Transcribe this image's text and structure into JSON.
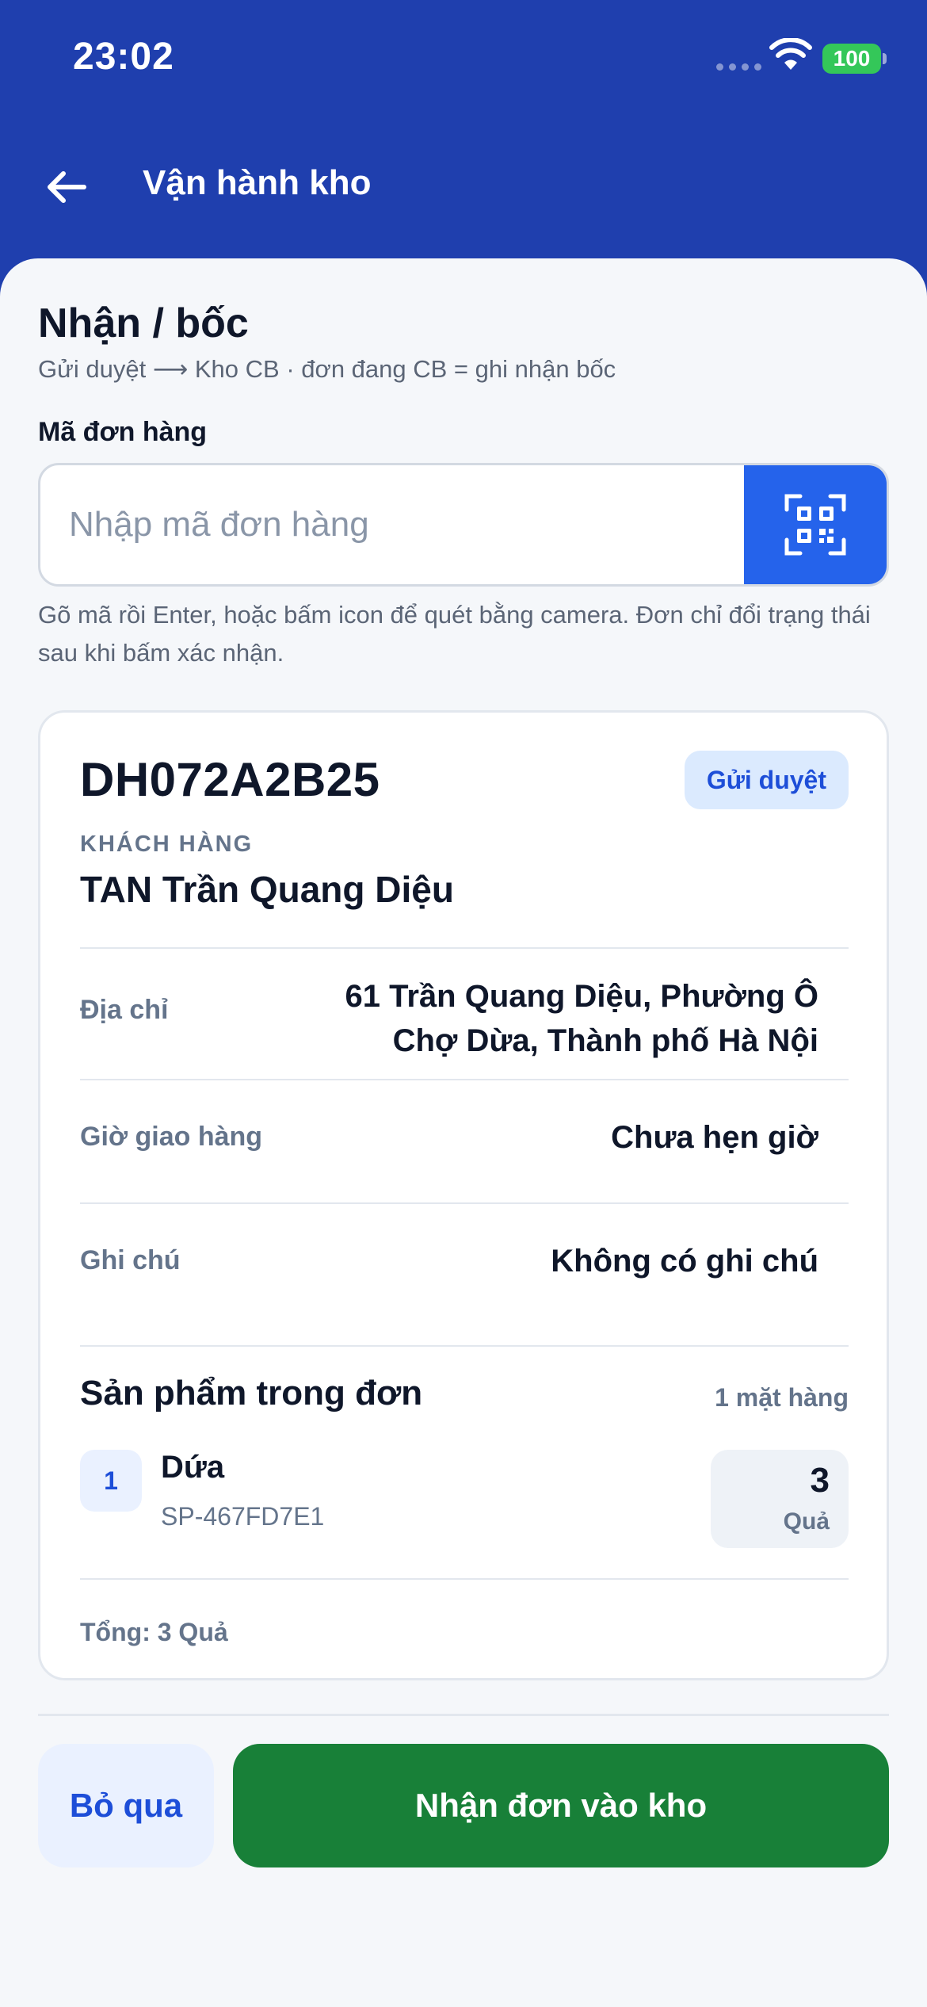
{
  "status_bar": {
    "time": "23:02",
    "battery": "100",
    "icons": [
      "signal-dots-icon",
      "wifi-icon",
      "battery-icon"
    ]
  },
  "nav": {
    "title": "Vận hành kho",
    "back_icon": "arrow-left-icon"
  },
  "section": {
    "title": "Nhận / bốc",
    "subtitle": "Gửi duyệt ⟶ Kho CB · đơn đang CB = ghi nhận bốc"
  },
  "order_field": {
    "label": "Mã đơn hàng",
    "value": "",
    "placeholder": "Nhập mã đơn hàng",
    "scan_icon": "qr-scan-icon",
    "helper": "Gõ mã rồi Enter, hoặc bấm icon để quét bằng camera. Đơn chỉ đổi trạng thái sau khi bấm xác nhận."
  },
  "order": {
    "code": "DH072A2B25",
    "status": "Gửi duyệt",
    "customer_label": "KHÁCH HÀNG",
    "customer_name": "TAN Trần Quang Diệu",
    "details": [
      {
        "label": "Địa chỉ",
        "value": "61 Trần Quang Diệu, Phường Ô Chợ Dừa, Thành phố Hà Nội"
      },
      {
        "label": "Giờ giao hàng",
        "value": "Chưa hẹn giờ"
      },
      {
        "label": "Ghi chú",
        "value": "Không có ghi chú"
      }
    ],
    "products_title": "Sản phẩm trong đơn",
    "products_count": "1 mặt hàng",
    "products": [
      {
        "index": "1",
        "name": "Dứa",
        "sku": "SP-467FD7E1",
        "qty": "3",
        "unit": "Quả"
      }
    ],
    "total": "Tổng: 3 Quả"
  },
  "actions": {
    "skip": "Bỏ qua",
    "receive": "Nhận đơn vào kho"
  },
  "colors": {
    "header_bg": "#1f3fae",
    "primary": "#2563eb",
    "success": "#188038",
    "badge_bg": "#dbeafe",
    "battery": "#34c759"
  }
}
